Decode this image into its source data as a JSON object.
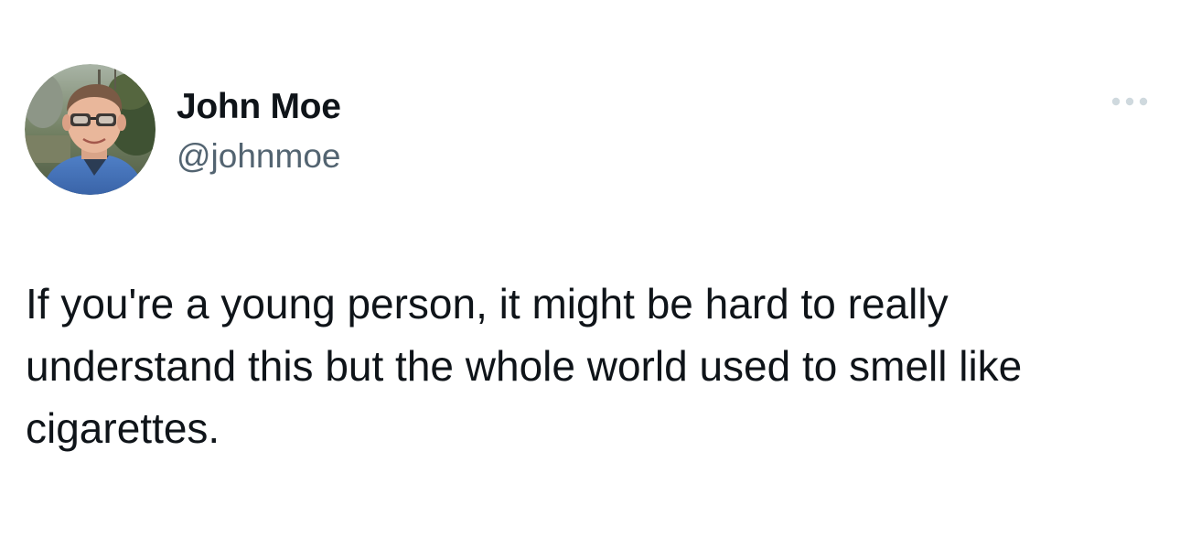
{
  "tweet": {
    "author": {
      "display_name": "John Moe",
      "handle": "@johnmoe",
      "avatar_icon": "profile-photo-avatar"
    },
    "more_icon": "more-options-icon",
    "text": "If you're a young person, it might be hard to really understand this but the whole world used to smell like cigarettes."
  },
  "colors": {
    "text_primary": "#0f1419",
    "text_secondary": "#536471",
    "background": "#ffffff",
    "more_dots": "#cfd9de"
  }
}
